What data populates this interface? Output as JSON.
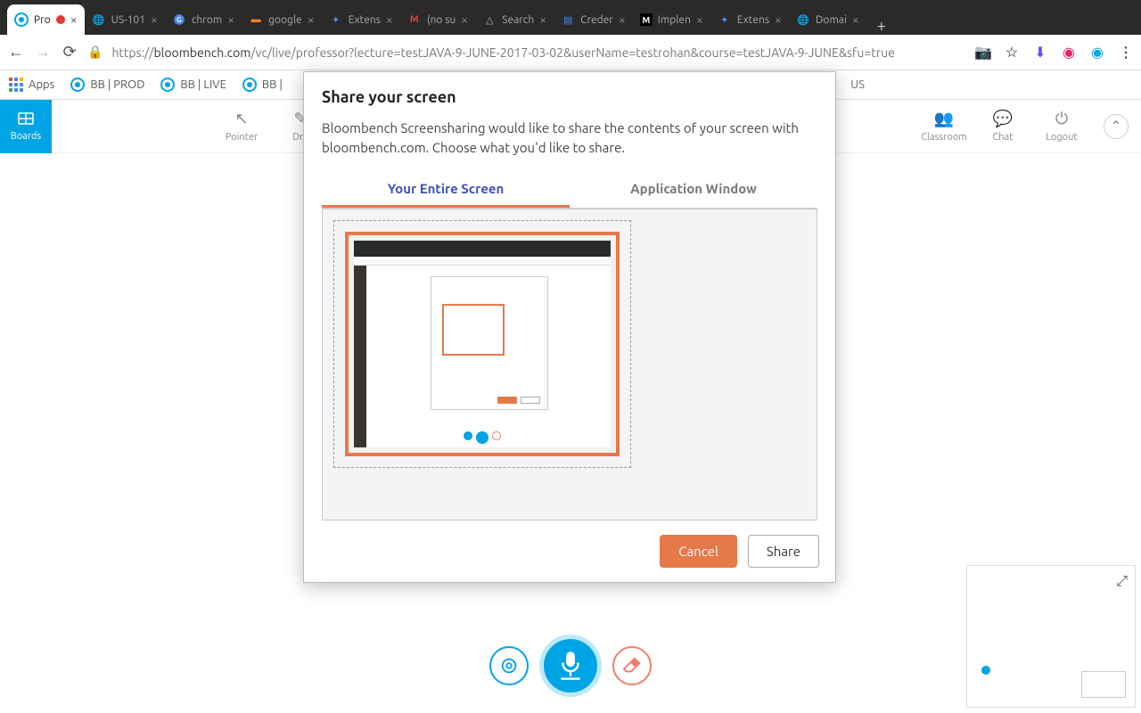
{
  "browser": {
    "tabs": [
      {
        "title": "Pro",
        "favicon": "bloombench"
      },
      {
        "title": "US-101",
        "favicon": "generic"
      },
      {
        "title": "chrom",
        "favicon": "google"
      },
      {
        "title": "google",
        "favicon": "stackoverflow"
      },
      {
        "title": "Extens",
        "favicon": "extension"
      },
      {
        "title": "(no su",
        "favicon": "gmail"
      },
      {
        "title": "Search",
        "favicon": "drive"
      },
      {
        "title": "Creder",
        "favicon": "docs"
      },
      {
        "title": "Implen",
        "favicon": "medium"
      },
      {
        "title": "Extens",
        "favicon": "extension"
      },
      {
        "title": "Domai",
        "favicon": "generic"
      }
    ],
    "url_prefix": "https://",
    "url_host": "bloombench.com",
    "url_path": "/vc/live/professor?lecture=testJAVA-9-JUNE-2017-03-02&userName=testrohan&course=testJAVA-9-JUNE&sfu=true"
  },
  "bookmarks": {
    "apps": "Apps",
    "items": [
      "BB | PROD",
      "BB | LIVE",
      "BB |"
    ]
  },
  "toolbar": {
    "boards": "Boards",
    "pointer": "Pointer",
    "draw": "Dra",
    "classroom": "Classroom",
    "chat": "Chat",
    "logout": "Logout",
    "status": "US"
  },
  "modal": {
    "title": "Share your screen",
    "body": "Bloombench Screensharing would like to share the contents of your screen with bloombench.com. Choose what you'd like to share.",
    "tab_entire": "Your Entire Screen",
    "tab_app": "Application Window",
    "cancel": "Cancel",
    "share": "Share"
  }
}
